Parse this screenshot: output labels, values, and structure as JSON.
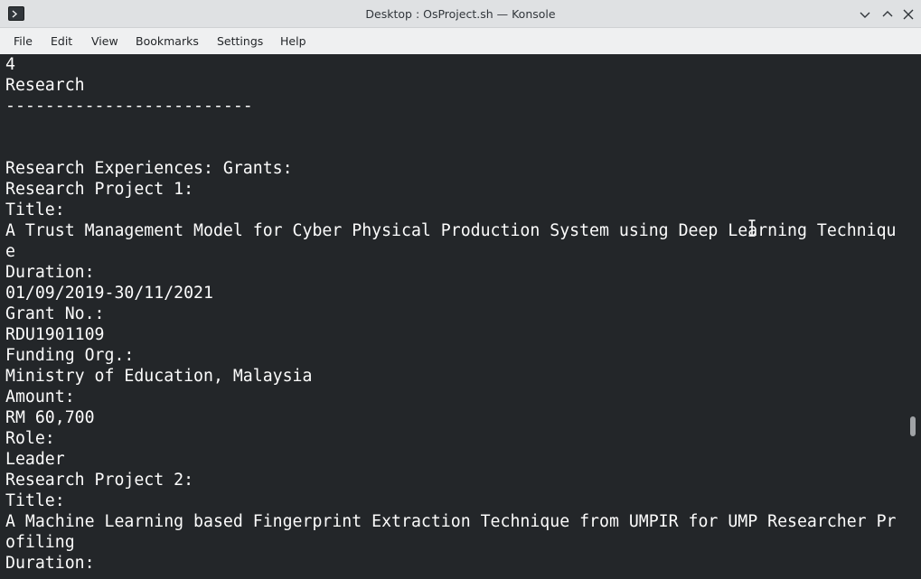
{
  "window": {
    "title": "Desktop : OsProject.sh — Konsole"
  },
  "menubar": {
    "items": [
      {
        "label": "File"
      },
      {
        "label": "Edit"
      },
      {
        "label": "View"
      },
      {
        "label": "Bookmarks"
      },
      {
        "label": "Settings"
      },
      {
        "label": "Help"
      }
    ]
  },
  "terminal": {
    "lines": [
      "4",
      "Research",
      "-------------------------",
      "",
      "",
      "Research Experiences: Grants:",
      "Research Project 1:",
      "Title:",
      "A Trust Management Model for Cyber Physical Production System using Deep Learning Techniqu",
      "e",
      "Duration:",
      "01/09/2019-30/11/2021",
      "Grant No.:",
      "RDU1901109",
      "Funding Org.:",
      "Ministry of Education, Malaysia",
      "Amount:",
      "RM 60,700",
      "Role:",
      "Leader",
      "Research Project 2:",
      "Title:",
      "A Machine Learning based Fingerprint Extraction Technique from UMPIR for UMP Researcher Pr",
      "ofiling",
      "Duration:"
    ]
  },
  "colors": {
    "terminal_bg": "#232629",
    "terminal_fg": "#fcfcfc",
    "titlebar_bg": "#dfe1e3",
    "menubar_bg": "#eff0f1"
  },
  "icons": {
    "app": "terminal-icon",
    "minimize": "chevron-down-icon",
    "maximize": "chevron-up-icon",
    "close": "close-icon"
  }
}
